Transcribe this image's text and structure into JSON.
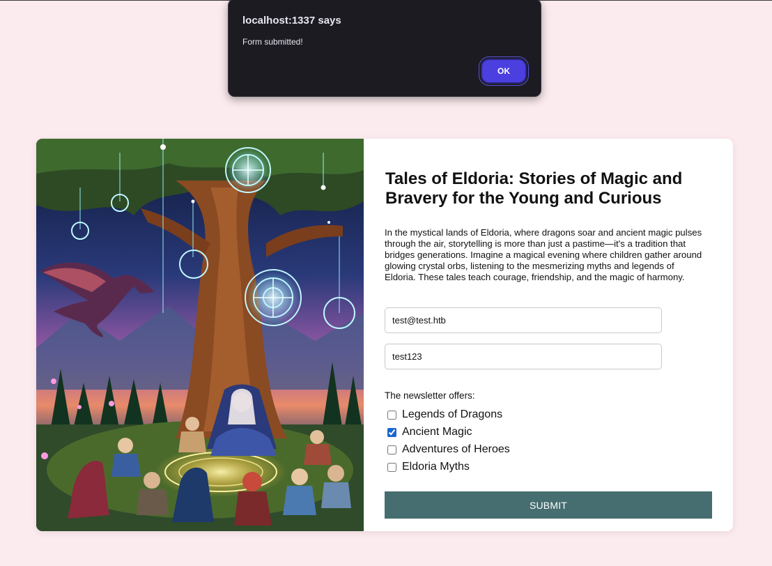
{
  "alert": {
    "title": "localhost:1337 says",
    "message": "Form submitted!",
    "ok_label": "OK"
  },
  "hero": {
    "title": "Tales of Eldoria: Stories of Magic and Bravery for the Young and Curious",
    "description": "In the mystical lands of Eldoria, where dragons soar and ancient magic pulses through the air, storytelling is more than just a pastime—it's a tradition that bridges generations. Imagine a magical evening where children gather around glowing crystal orbs, listening to the mesmerizing myths and legends of Eldoria. These tales teach courage, friendship, and the magic of harmony."
  },
  "form": {
    "email_value": "test@test.htb",
    "password_value": "test123",
    "offers_label": "The newsletter offers:",
    "options": [
      {
        "label": "Legends of Dragons",
        "checked": false
      },
      {
        "label": "Ancient Magic",
        "checked": true
      },
      {
        "label": "Adventures of Heroes",
        "checked": false
      },
      {
        "label": "Eldoria Myths",
        "checked": false
      }
    ],
    "submit_label": "SUBMIT"
  },
  "colors": {
    "page_background": "#fbeaee",
    "submit_button": "#466d6f",
    "alert_ok": "#4b3fe0",
    "alert_background": "#1c1b21"
  }
}
